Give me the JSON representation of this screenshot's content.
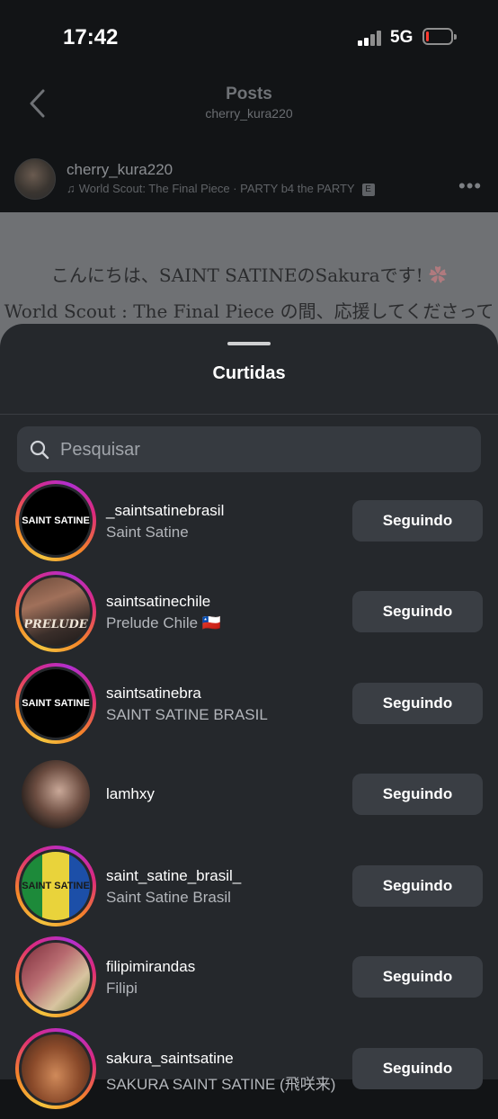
{
  "status_bar": {
    "time": "17:42",
    "network": "5G"
  },
  "header": {
    "title": "Posts",
    "subtitle": "cherry_kura220"
  },
  "post": {
    "username": "cherry_kura220",
    "music": "World Scout: The Final Piece · PARTY b4 the PARTY",
    "explicit_badge": "E",
    "image_text_line1": "こんにちは、SAINT SATINEのSakuraです!",
    "image_text_line2": "World Scout : The Final Piece の間、応援してくださって"
  },
  "sheet": {
    "title": "Curtidas",
    "search_placeholder": "Pesquisar",
    "follow_label": "Seguindo",
    "users": [
      {
        "username": "_saintsatinebrasil",
        "name": "Saint Satine",
        "avatar_text": "SAINT SATINE",
        "has_story": true
      },
      {
        "username": "saintsatinechile",
        "name": "Prelude Chile 🇨🇱",
        "avatar_text": "PRELUDE",
        "has_story": true
      },
      {
        "username": "saintsatinebra",
        "name": "SAINT SATINE BRASIL",
        "avatar_text": "SAINT SATINE",
        "has_story": true
      },
      {
        "username": "lamhxy",
        "name": "",
        "avatar_text": "",
        "has_story": false
      },
      {
        "username": "saint_satine_brasil_",
        "name": "Saint Satine Brasil",
        "avatar_text": "SAINT SATINE",
        "has_story": true
      },
      {
        "username": "filipimirandas",
        "name": "Filipi",
        "avatar_text": "",
        "has_story": true
      },
      {
        "username": "sakura_saintsatine",
        "name": "SAKURA SAINT SATINE (飛咲来)",
        "avatar_text": "",
        "has_story": true
      }
    ]
  }
}
